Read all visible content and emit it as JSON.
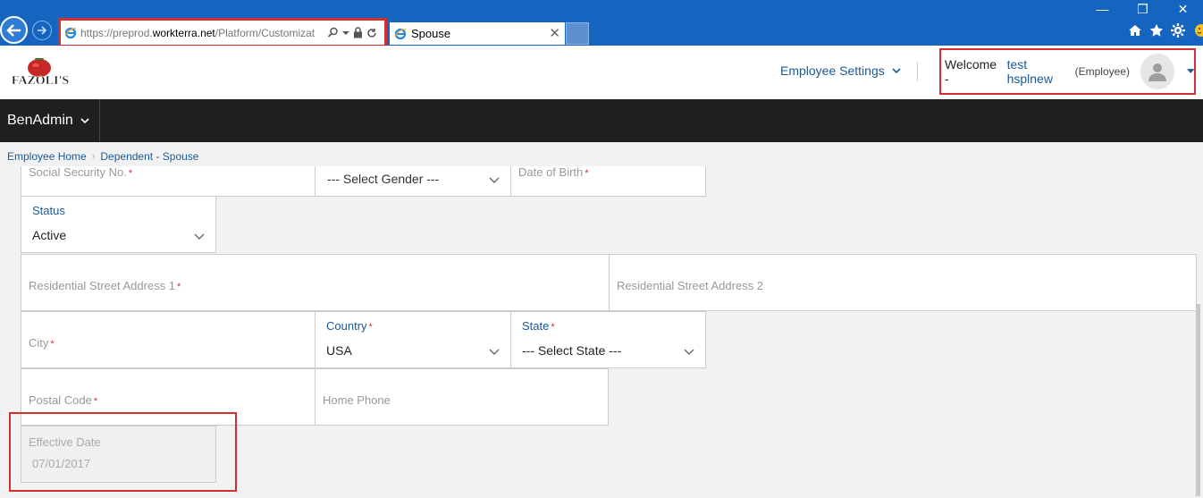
{
  "browser": {
    "url_prefix": "https://preprod.",
    "url_domain": "workterra.net",
    "url_path": "/Platform/Customizat",
    "tab_title": "Spouse",
    "tab_close": "✕",
    "window_controls": [
      "—",
      "❐",
      "✕"
    ]
  },
  "header": {
    "logo_text": "FAZOLI'S",
    "employee_settings": "Employee Settings",
    "welcome_label": "Welcome -",
    "user_name": "test hsplnew",
    "user_role": "(Employee)"
  },
  "navbar": {
    "menu_label": "BenAdmin"
  },
  "breadcrumb": {
    "items": [
      "Employee Home",
      "Dependent - Spouse"
    ]
  },
  "form": {
    "ssn_placeholder": "Social Security No.",
    "gender_value": "--- Select Gender ---",
    "dob_placeholder": "Date of Birth",
    "status_label": "Status",
    "status_value": "Active",
    "address1_placeholder": "Residential Street Address 1",
    "address2_placeholder": "Residential Street Address 2",
    "city_placeholder": "City",
    "country_label": "Country",
    "country_value": "USA",
    "state_label": "State",
    "state_value": "--- Select State ---",
    "postal_placeholder": "Postal Code",
    "home_phone_placeholder": "Home Phone",
    "effective_date_label": "Effective Date",
    "effective_date_value": "07/01/2017",
    "required_marker": "*"
  },
  "colors": {
    "chrome_blue": "#1565c0",
    "link_blue": "#1b5a96",
    "navbar_bg": "#1f1f1f",
    "highlight_red": "#d32f2f"
  }
}
